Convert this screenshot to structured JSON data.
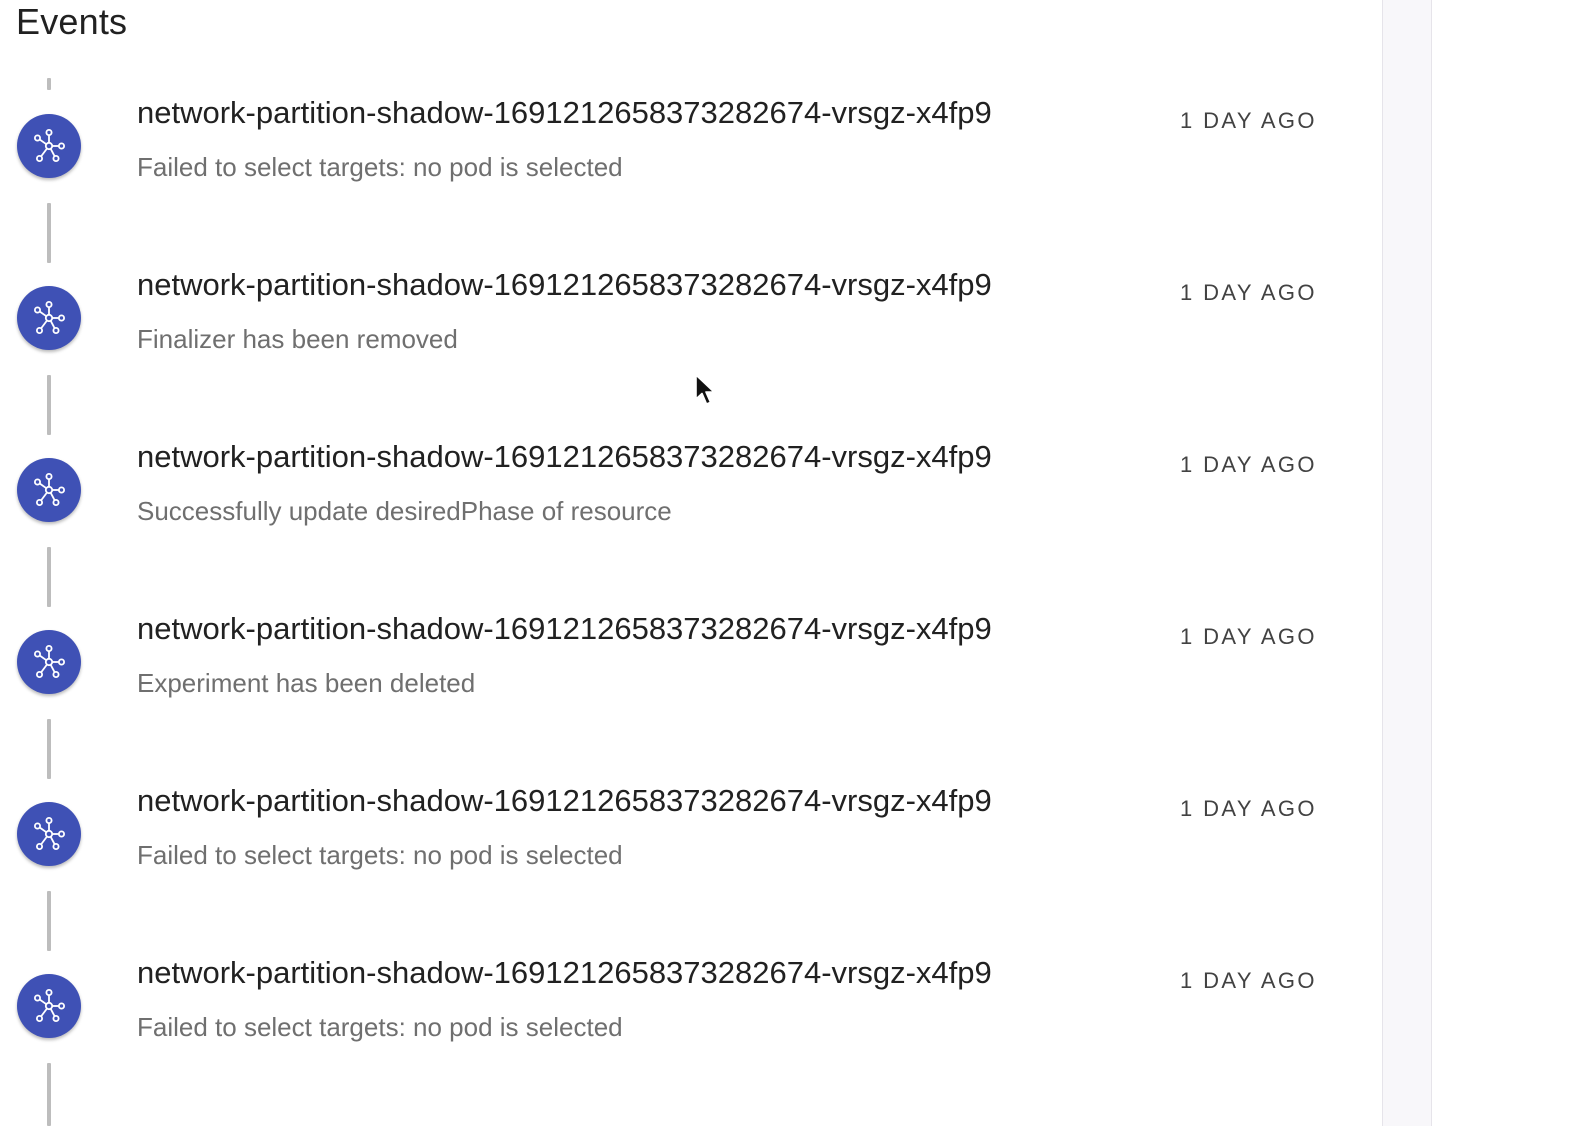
{
  "page": {
    "title": "Events"
  },
  "events": [
    {
      "title": "network-partition-shadow-1691212658373282674-vrsgz-x4fp9",
      "message": "Failed to select targets: no pod is selected",
      "time": "1 DAY AGO",
      "icon": "hub-network-icon"
    },
    {
      "title": "network-partition-shadow-1691212658373282674-vrsgz-x4fp9",
      "message": "Finalizer has been removed",
      "time": "1 DAY AGO",
      "icon": "hub-network-icon"
    },
    {
      "title": "network-partition-shadow-1691212658373282674-vrsgz-x4fp9",
      "message": "Successfully update desiredPhase of resource",
      "time": "1 DAY AGO",
      "icon": "hub-network-icon"
    },
    {
      "title": "network-partition-shadow-1691212658373282674-vrsgz-x4fp9",
      "message": "Experiment has been deleted",
      "time": "1 DAY AGO",
      "icon": "hub-network-icon"
    },
    {
      "title": "network-partition-shadow-1691212658373282674-vrsgz-x4fp9",
      "message": "Failed to select targets: no pod is selected",
      "time": "1 DAY AGO",
      "icon": "hub-network-icon"
    },
    {
      "title": "network-partition-shadow-1691212658373282674-vrsgz-x4fp9",
      "message": "Failed to select targets: no pod is selected",
      "time": "1 DAY AGO",
      "icon": "hub-network-icon"
    }
  ],
  "colors": {
    "accent": "#3f51b5",
    "connector": "#bdbdbd",
    "title_text": "#212121",
    "secondary_text": "#6f6f6f"
  }
}
